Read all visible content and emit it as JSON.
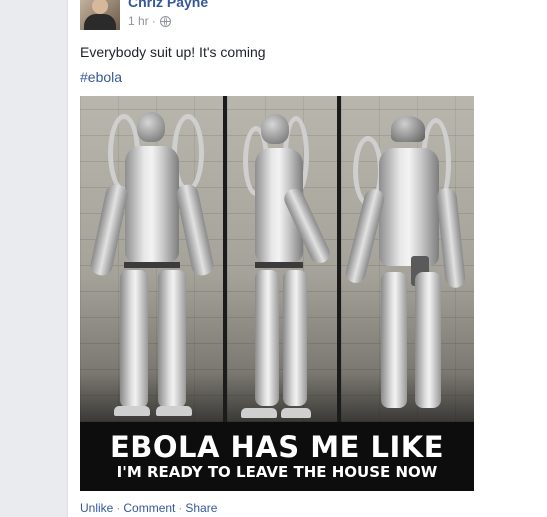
{
  "post": {
    "author": "Chriz Payne",
    "time": "1 hr",
    "meta_separator": "·",
    "text": "Everybody suit up! It's coming",
    "hashtag": "#ebola"
  },
  "photo": {
    "caption_line1": "EBOLA HAS ME LIKE",
    "caption_line2": "I'M READY TO LEAVE THE HOUSE NOW"
  },
  "actions": {
    "unlike": "Unlike",
    "comment": "Comment",
    "share": "Share",
    "separator": "·"
  },
  "colors": {
    "link": "#365899",
    "meta": "#90949c",
    "text": "#1d2129",
    "background": "#e9ebee"
  },
  "icons": {
    "privacy": "globe-icon"
  }
}
